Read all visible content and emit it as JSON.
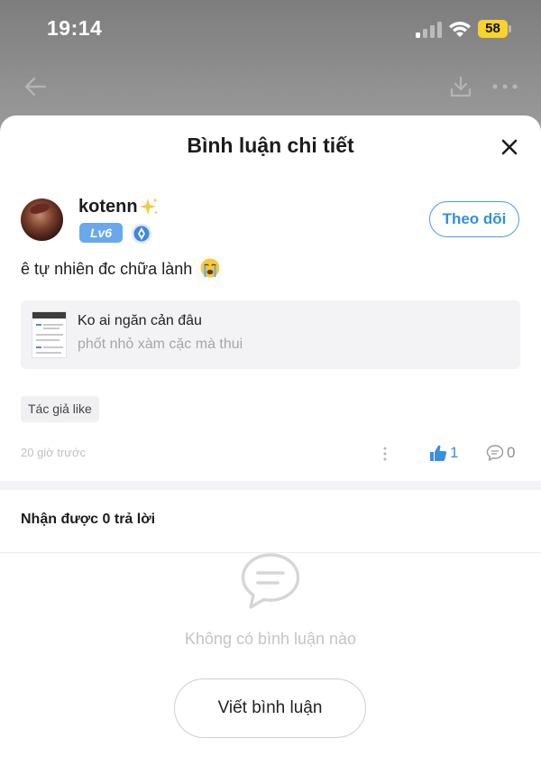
{
  "status_bar": {
    "time": "19:14",
    "battery_level": "58",
    "battery_color": "#f7d32b"
  },
  "nav_icons": [
    "back-arrow-icon",
    "download-icon",
    "more-icon"
  ],
  "sheet": {
    "title": "Bình luận chi tiết",
    "close_icon": "close-icon"
  },
  "comment": {
    "username": "kotenn",
    "level": "Lv6",
    "follow_label": "Theo dõi",
    "text": "ê tự nhiên đc chữa lành",
    "quote": {
      "title": "Ko ai ngăn cản đâu",
      "subtitle": "phốt nhỏ xàm cặc mà thui"
    },
    "tag": "Tác giả like",
    "timestamp": "20 giờ trước",
    "like_count": "1",
    "reply_count": "0"
  },
  "replies": {
    "heading": "Nhận được 0 trả lời",
    "empty_text": "Không có bình luận nào",
    "write_button": "Viết bình luận"
  },
  "colors": {
    "accent": "#2f8fe3",
    "level_badge": "#6aa8ee"
  }
}
